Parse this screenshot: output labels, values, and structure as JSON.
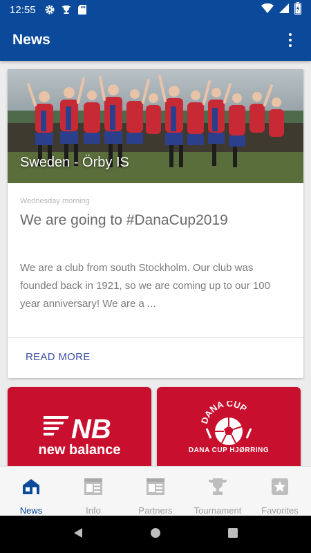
{
  "status_bar": {
    "time": "12:55",
    "icons": [
      "gear-icon",
      "trophy-icon",
      "sd-card-icon",
      "wifi-icon",
      "signal-icon",
      "battery-icon"
    ]
  },
  "app_bar": {
    "title": "News",
    "menu_icon": "more-vert-icon"
  },
  "news_card": {
    "image_caption": "Sweden - Örby IS",
    "date": "Wednesday morning",
    "title": "We are going to #DanaCup2019",
    "excerpt": "We are a club from south Stockholm. Our club was founded back in 1921, so we are coming up to our 100 year anniversary! We are a ...",
    "action_label": "READ MORE"
  },
  "partners": [
    {
      "name": "new balance",
      "brand_color": "#c8102e"
    },
    {
      "name": "DANA CUP HJØRRING",
      "brand_color": "#c8102e"
    }
  ],
  "bottom_nav": {
    "items": [
      {
        "label": "News",
        "icon": "home-icon",
        "active": true
      },
      {
        "label": "Info",
        "icon": "article-icon",
        "active": false
      },
      {
        "label": "Partners",
        "icon": "article-icon",
        "active": false
      },
      {
        "label": "Tournament",
        "icon": "trophy-icon",
        "active": false
      },
      {
        "label": "Favorites",
        "icon": "star-icon",
        "active": false
      }
    ]
  },
  "system_nav": [
    "back-icon",
    "home-icon",
    "recents-icon"
  ],
  "colors": {
    "primary": "#0b4a9a",
    "accent_link": "#3a4fa5",
    "partner_red": "#c8102e"
  }
}
